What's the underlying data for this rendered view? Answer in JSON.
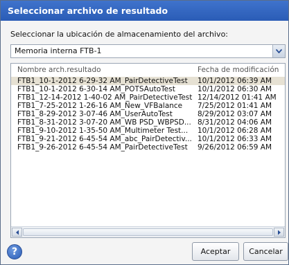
{
  "dialog": {
    "title": "Seleccionar archivo de resultado",
    "prompt": "Seleccionar la ubicación de almacenamiento del archivo:",
    "location_select": {
      "value": "Memoria interna FTB-1"
    }
  },
  "file_list": {
    "columns": [
      "Nombre arch.resultado",
      "Fecha de modificación"
    ],
    "rows": [
      {
        "name": "FTB1_10-1-2012 6-29-32 AM_PairDetectiveTest",
        "date": "10/1/2012 06:39 AM",
        "selected": true
      },
      {
        "name": "FTB1_10-1-2012 6-30-14 AM_POTSAutoTest",
        "date": "10/1/2012 06:30 AM"
      },
      {
        "name": "FTB1_12-14-2012 1-40-02 AM_PairDetectiveTest",
        "date": "12/14/2012 01:41 AM"
      },
      {
        "name": "FTB1_7-25-2012 1-26-16 AM_New_VFBalance",
        "date": "7/25/2012 01:41 AM"
      },
      {
        "name": "FTB1_8-29-2012 3-07-46 AM_UserAutoTest",
        "date": "8/29/2012 03:07 AM"
      },
      {
        "name": "FTB1_8-31-2012 3-07-20 AM_WB PSD_WBPSD...",
        "date": "8/31/2012 04:06 AM"
      },
      {
        "name": "FTB1_9-10-2012 1-35-50 AM_Multimeter Test...",
        "date": "10/1/2012 06:28 AM"
      },
      {
        "name": "FTB1_9-21-2012 6-45-54 AM_abc_PairDetectiv...",
        "date": "10/1/2012 06:33 AM"
      },
      {
        "name": "FTB1_9-26-2012 6-45-54 AM_PairDetectiveTest",
        "date": "9/26/2012 06:59 AM"
      }
    ]
  },
  "footer": {
    "help_label": "?",
    "ok_label": "Aceptar",
    "cancel_label": "Cancelar"
  }
}
